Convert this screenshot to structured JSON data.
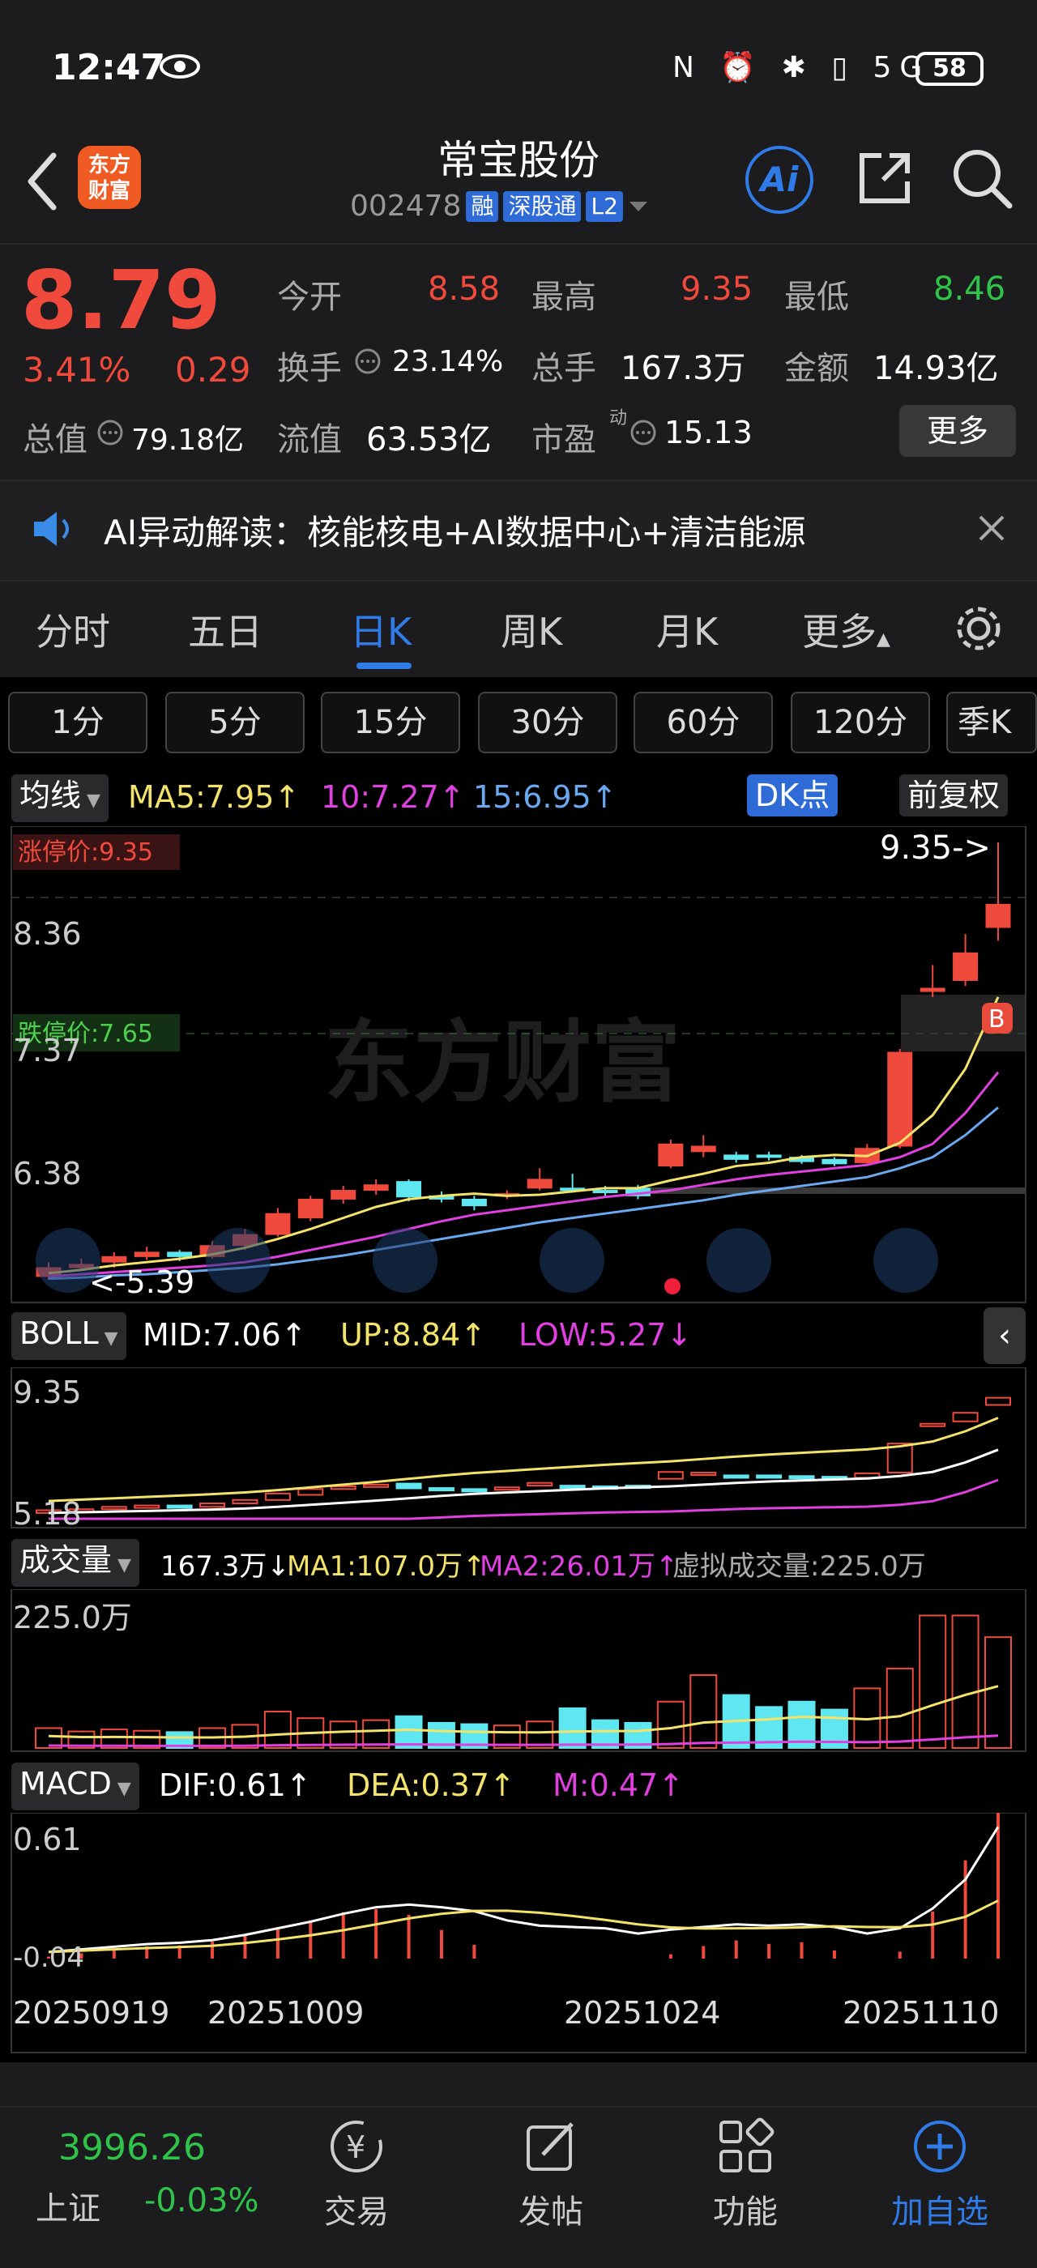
{
  "status_bar": {
    "time": "12:47",
    "icons": "N ⏰ ✱ ▯ 5G",
    "battery": "58"
  },
  "header": {
    "logo": "东方财富",
    "stock_name": "常宝股份",
    "code": "002478",
    "tags": [
      "融",
      "深股通",
      "L2"
    ]
  },
  "quote": {
    "price": "8.79",
    "change_pct": "3.41%",
    "change_abs": "0.29",
    "open_label": "今开",
    "open": "8.58",
    "high_label": "最高",
    "high": "9.35",
    "low_label": "最低",
    "low": "8.46",
    "turnover_label": "换手",
    "turnover": "23.14%",
    "volume_label": "总手",
    "volume": "167.3万",
    "amount_label": "金额",
    "amount": "14.93亿",
    "mktcap_label": "总值",
    "mktcap": "79.18亿",
    "float_label": "流值",
    "float": "63.53亿",
    "pe_label": "市盈",
    "pe_sup": "动",
    "pe": "15.13",
    "more_label": "更多"
  },
  "ai_news": {
    "text": "AI异动解读：核能核电+AI数据中心+清洁能源"
  },
  "tabs": [
    "分时",
    "五日",
    "日K",
    "周K",
    "月K",
    "更多"
  ],
  "periods": [
    "1分",
    "5分",
    "15分",
    "30分",
    "60分",
    "120分",
    "季K"
  ],
  "ma_bar": {
    "selector": "均线",
    "ma5": "MA5:7.95↑",
    "ma10": "10:7.27↑",
    "ma15": "15:6.95↑",
    "dk": "DK点",
    "adj": "前复权"
  },
  "kline_labels": {
    "limit_up": "涨停价:9.35",
    "limit_down": "跌停价:7.65",
    "y1": "8.36",
    "y2": "7.37",
    "y3": "6.38",
    "high_marker": "9.35->",
    "low_marker": "<-5.39",
    "watermark": "东方财富",
    "b_marker": "B"
  },
  "boll": {
    "selector": "BOLL",
    "mid": "MID:7.06↑",
    "up": "UP:8.84↑",
    "low": "LOW:5.27↓",
    "ytop": "9.35",
    "ybot": "5.18"
  },
  "volume": {
    "selector": "成交量",
    "vol": "167.3万↓",
    "ma1": "MA1:107.0万↑",
    "ma2": "MA2:26.01万↑",
    "virtual": "虚拟成交量:225.0万",
    "ytop": "225.0万"
  },
  "macd": {
    "selector": "MACD",
    "dif": "DIF:0.61↑",
    "dea": "DEA:0.37↑",
    "m": "M:0.47↑",
    "ytop": "0.61",
    "ybot": "-0.04"
  },
  "xaxis": [
    "20250919",
    "20251009",
    "20251024",
    "20251110"
  ],
  "bottom_nav": {
    "index_value": "3996.26",
    "index_name": "上证",
    "index_change": "-0.03%",
    "items": [
      "交易",
      "发帖",
      "功能",
      "加自选"
    ]
  },
  "colors": {
    "up": "#f04a3c",
    "down": "#5ee7f0",
    "ma5": "#f4e36a",
    "ma10": "#e040e0",
    "ma15": "#6aa8f0",
    "accent": "#2f7be8"
  },
  "chart_data": {
    "type": "candlestick",
    "candles": [
      {
        "o": 5.42,
        "c": 5.5,
        "h": 5.55,
        "l": 5.39,
        "up": true
      },
      {
        "o": 5.5,
        "c": 5.53,
        "h": 5.58,
        "l": 5.47,
        "up": true
      },
      {
        "o": 5.55,
        "c": 5.6,
        "h": 5.64,
        "l": 5.5,
        "up": true
      },
      {
        "o": 5.6,
        "c": 5.64,
        "h": 5.69,
        "l": 5.57,
        "up": true
      },
      {
        "o": 5.64,
        "c": 5.6,
        "h": 5.66,
        "l": 5.56,
        "up": false
      },
      {
        "o": 5.6,
        "c": 5.7,
        "h": 5.74,
        "l": 5.58,
        "up": true
      },
      {
        "o": 5.7,
        "c": 5.8,
        "h": 5.85,
        "l": 5.66,
        "up": true
      },
      {
        "o": 5.8,
        "c": 5.99,
        "h": 6.04,
        "l": 5.78,
        "up": true
      },
      {
        "o": 5.95,
        "c": 6.12,
        "h": 6.15,
        "l": 5.92,
        "up": true
      },
      {
        "o": 6.12,
        "c": 6.2,
        "h": 6.24,
        "l": 6.08,
        "up": true
      },
      {
        "o": 6.2,
        "c": 6.25,
        "h": 6.3,
        "l": 6.16,
        "up": true
      },
      {
        "o": 6.28,
        "c": 6.14,
        "h": 6.3,
        "l": 6.1,
        "up": false
      },
      {
        "o": 6.15,
        "c": 6.12,
        "h": 6.19,
        "l": 6.09,
        "up": false
      },
      {
        "o": 6.12,
        "c": 6.06,
        "h": 6.15,
        "l": 6.02,
        "up": false
      },
      {
        "o": 6.15,
        "c": 6.17,
        "h": 6.2,
        "l": 6.12,
        "up": true
      },
      {
        "o": 6.22,
        "c": 6.3,
        "h": 6.4,
        "l": 6.2,
        "up": true
      },
      {
        "o": 6.22,
        "c": 6.2,
        "h": 6.35,
        "l": 6.18,
        "up": false
      },
      {
        "o": 6.2,
        "c": 6.18,
        "h": 6.24,
        "l": 6.14,
        "up": false
      },
      {
        "o": 6.22,
        "c": 6.15,
        "h": 6.25,
        "l": 6.12,
        "up": false
      },
      {
        "o": 6.42,
        "c": 6.62,
        "h": 6.66,
        "l": 6.4,
        "up": true
      },
      {
        "o": 6.6,
        "c": 6.55,
        "h": 6.7,
        "l": 6.5,
        "up": true
      },
      {
        "o": 6.52,
        "c": 6.48,
        "h": 6.55,
        "l": 6.45,
        "up": false
      },
      {
        "o": 6.52,
        "c": 6.5,
        "h": 6.55,
        "l": 6.47,
        "up": false
      },
      {
        "o": 6.5,
        "c": 6.46,
        "h": 6.52,
        "l": 6.44,
        "up": false
      },
      {
        "o": 6.48,
        "c": 6.44,
        "h": 6.5,
        "l": 6.42,
        "up": false
      },
      {
        "o": 6.45,
        "c": 6.58,
        "h": 6.62,
        "l": 6.44,
        "up": true
      },
      {
        "o": 6.6,
        "c": 7.45,
        "h": 7.48,
        "l": 6.58,
        "up": true
      },
      {
        "o": 8.0,
        "c": 8.03,
        "h": 8.24,
        "l": 7.95,
        "up": true
      },
      {
        "o": 8.1,
        "c": 8.35,
        "h": 8.52,
        "l": 8.05,
        "up": true
      },
      {
        "o": 8.58,
        "c": 8.79,
        "h": 9.35,
        "l": 8.46,
        "up": true
      }
    ],
    "ma5": [
      5.45,
      5.48,
      5.52,
      5.55,
      5.58,
      5.62,
      5.68,
      5.76,
      5.85,
      5.95,
      6.05,
      6.12,
      6.15,
      6.17,
      6.15,
      6.16,
      6.19,
      6.22,
      6.22,
      6.29,
      6.35,
      6.42,
      6.45,
      6.5,
      6.52,
      6.51,
      6.63,
      6.88,
      7.3,
      7.95
    ],
    "ma10": [
      5.42,
      5.44,
      5.46,
      5.48,
      5.5,
      5.52,
      5.55,
      5.6,
      5.66,
      5.72,
      5.78,
      5.85,
      5.92,
      5.98,
      6.02,
      6.06,
      6.1,
      6.14,
      6.17,
      6.2,
      6.25,
      6.3,
      6.34,
      6.37,
      6.4,
      6.43,
      6.5,
      6.62,
      6.9,
      7.27
    ],
    "ma15": [
      5.4,
      5.41,
      5.43,
      5.44,
      5.46,
      5.48,
      5.5,
      5.53,
      5.57,
      5.61,
      5.66,
      5.71,
      5.76,
      5.81,
      5.86,
      5.91,
      5.95,
      5.99,
      6.03,
      6.07,
      6.11,
      6.16,
      6.2,
      6.24,
      6.28,
      6.32,
      6.4,
      6.5,
      6.7,
      6.95
    ],
    "volume": [
      30,
      25,
      28,
      26,
      24,
      30,
      35,
      55,
      45,
      40,
      42,
      48,
      38,
      36,
      34,
      40,
      60,
      42,
      38,
      70,
      110,
      80,
      62,
      70,
      58,
      90,
      120,
      200,
      200,
      167.3
    ],
    "ymax_price": 9.35,
    "ymin_price": 5.39,
    "ymax_vol": 225.0,
    "x_ticks": [
      "20250919",
      "20251009",
      "20251024",
      "20251110"
    ]
  }
}
